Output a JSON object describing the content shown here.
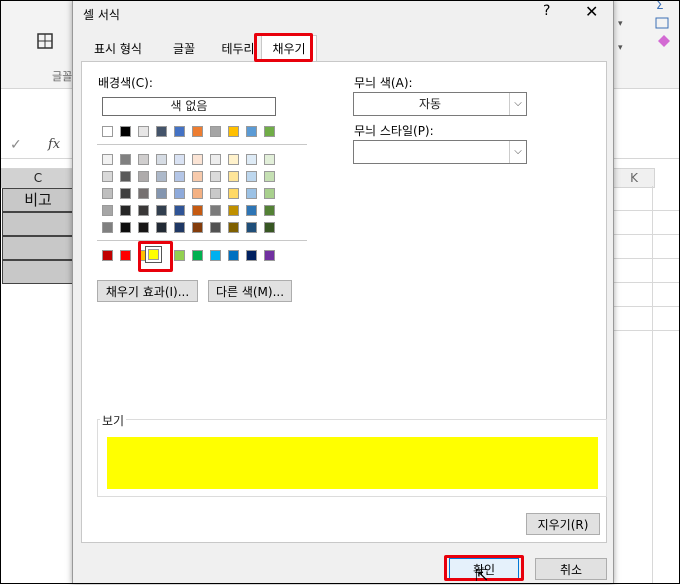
{
  "excel": {
    "ribbon_group_label": "글꼴",
    "fx_label": "fx",
    "col_c": "C",
    "col_k": "K",
    "cell_c_header": "비고"
  },
  "dialog": {
    "title": "셀 서식",
    "help": "?",
    "close": "✕",
    "tabs": [
      {
        "label": "표시 형식"
      },
      {
        "label": "글꼴"
      },
      {
        "label": "테두리"
      },
      {
        "label": "채우기",
        "active": true
      }
    ],
    "background_label": "배경색(C):",
    "no_color": "색 없음",
    "theme_row_colors": [
      "#ffffff",
      "#000000",
      "#e7e6e6",
      "#44546a",
      "#4472c4",
      "#ed7d31",
      "#a5a5a5",
      "#ffc000",
      "#5b9bd5",
      "#70ad47"
    ],
    "tint_rows": [
      [
        "#f2f2f2",
        "#808080",
        "#d0cece",
        "#d6dce4",
        "#d9e2f3",
        "#fbe4d5",
        "#ededed",
        "#fff2cc",
        "#deebf6",
        "#e2efd9"
      ],
      [
        "#d9d9d9",
        "#595959",
        "#aeabab",
        "#adb9ca",
        "#b4c6e7",
        "#f7caac",
        "#dbdbdb",
        "#fee599",
        "#bdd7ee",
        "#c5e0b3"
      ],
      [
        "#bfbfbf",
        "#404040",
        "#757070",
        "#8496b0",
        "#8eaadb",
        "#f4b183",
        "#c9c9c9",
        "#ffd965",
        "#9cc2e5",
        "#a8d08d"
      ],
      [
        "#a6a6a6",
        "#262626",
        "#3a3838",
        "#323f4f",
        "#2f5496",
        "#c55a11",
        "#7b7b7b",
        "#bf9000",
        "#2e75b5",
        "#538135"
      ],
      [
        "#808080",
        "#0d0d0d",
        "#171616",
        "#222a35",
        "#1f3864",
        "#833c0b",
        "#525252",
        "#7f6000",
        "#1f4e79",
        "#375623"
      ]
    ],
    "standard_colors": [
      "#c00000",
      "#ff0000",
      "#ffc000",
      "#ffff00",
      "#92d050",
      "#00b050",
      "#00b0f0",
      "#0070c0",
      "#002060",
      "#7030a0"
    ],
    "fill_effects_button": "채우기 효과(I)...",
    "more_colors_button": "다른 색(M)...",
    "pattern_color_label": "무늬 색(A):",
    "pattern_color_value": "자동",
    "pattern_style_label": "무늬 스타일(P):",
    "pattern_style_value": "",
    "preview_label": "보기",
    "preview_color": "#ffff00",
    "clear_button": "지우기(R)",
    "ok_button": "확인",
    "cancel_button": "취소",
    "highlight_color": "#e8000b"
  }
}
